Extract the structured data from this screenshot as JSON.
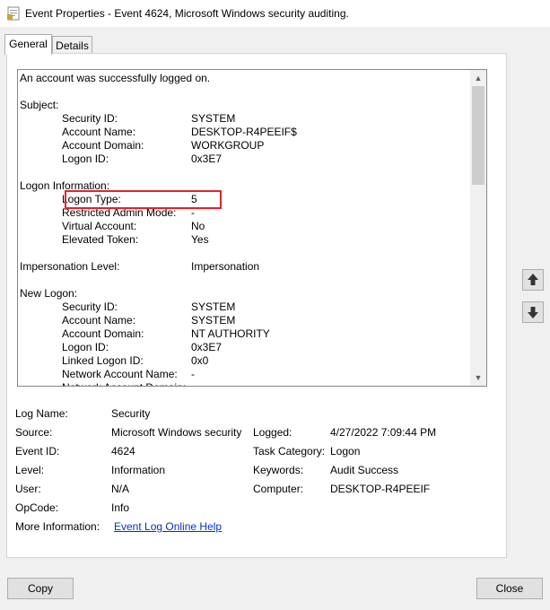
{
  "window": {
    "title": "Event Properties - Event 4624, Microsoft Windows security auditing."
  },
  "tabs": [
    {
      "label": "General"
    },
    {
      "label": "Details"
    }
  ],
  "description_lines": [
    {
      "label": "An account was successfully logged on.",
      "value": "",
      "indent": 0
    },
    {
      "label": "",
      "value": "",
      "indent": 0
    },
    {
      "label": "Subject:",
      "value": "",
      "indent": 0
    },
    {
      "label": "Security ID:",
      "value": "SYSTEM",
      "indent": 1
    },
    {
      "label": "Account Name:",
      "value": "DESKTOP-R4PEEIF$",
      "indent": 1
    },
    {
      "label": "Account Domain:",
      "value": "WORKGROUP",
      "indent": 1
    },
    {
      "label": "Logon ID:",
      "value": "0x3E7",
      "indent": 1
    },
    {
      "label": "",
      "value": "",
      "indent": 0
    },
    {
      "label": "Logon Information:",
      "value": "",
      "indent": 0
    },
    {
      "label": "Logon Type:",
      "value": "5",
      "indent": 1
    },
    {
      "label": "Restricted Admin Mode:",
      "value": "-",
      "indent": 1
    },
    {
      "label": "Virtual Account:",
      "value": "No",
      "indent": 1
    },
    {
      "label": "Elevated Token:",
      "value": "Yes",
      "indent": 1
    },
    {
      "label": "",
      "value": "",
      "indent": 0
    },
    {
      "label": "Impersonation Level:",
      "value": "Impersonation",
      "indent": 0
    },
    {
      "label": "",
      "value": "",
      "indent": 0
    },
    {
      "label": "New Logon:",
      "value": "",
      "indent": 0
    },
    {
      "label": "Security ID:",
      "value": "SYSTEM",
      "indent": 1
    },
    {
      "label": "Account Name:",
      "value": "SYSTEM",
      "indent": 1
    },
    {
      "label": "Account Domain:",
      "value": "NT AUTHORITY",
      "indent": 1
    },
    {
      "label": "Logon ID:",
      "value": "0x3E7",
      "indent": 1
    },
    {
      "label": "Linked Logon ID:",
      "value": "0x0",
      "indent": 1
    },
    {
      "label": "Network Account Name:",
      "value": "-",
      "indent": 1
    },
    {
      "label": "Network Account Domain:",
      "value": "-",
      "indent": 1
    }
  ],
  "fields": {
    "log_name": {
      "label": "Log Name:",
      "value": "Security"
    },
    "source": {
      "label": "Source:",
      "value": "Microsoft Windows security"
    },
    "logged": {
      "label": "Logged:",
      "value": "4/27/2022 7:09:44 PM"
    },
    "event_id": {
      "label": "Event ID:",
      "value": "4624"
    },
    "task_category": {
      "label": "Task Category:",
      "value": "Logon"
    },
    "level": {
      "label": "Level:",
      "value": "Information"
    },
    "keywords": {
      "label": "Keywords:",
      "value": "Audit Success"
    },
    "user": {
      "label": "User:",
      "value": "N/A"
    },
    "computer": {
      "label": "Computer:",
      "value": "DESKTOP-R4PEEIF"
    },
    "opcode": {
      "label": "OpCode:",
      "value": "Info"
    },
    "more_info": {
      "label": "More Information:",
      "value": "Event Log Online Help"
    }
  },
  "buttons": {
    "copy": "Copy",
    "close": "Close"
  },
  "icons": {
    "title": "event-properties-icon",
    "up": "arrow-up-icon",
    "down": "arrow-down-icon",
    "scroll_up": "scroll-up-icon",
    "scroll_down": "scroll-down-icon"
  },
  "colors": {
    "highlight": "#e0232b",
    "link": "#0033cc"
  }
}
